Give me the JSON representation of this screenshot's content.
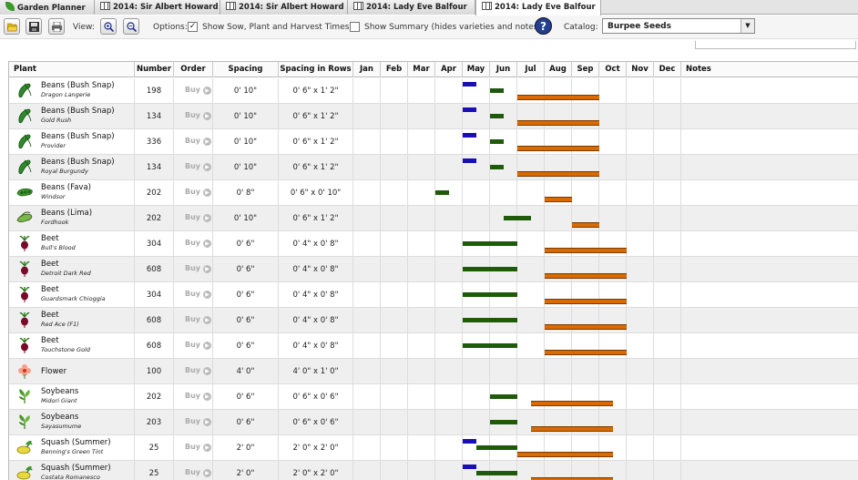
{
  "tabs": [
    {
      "label": "Garden Planner",
      "icon": "leaf-icon",
      "active": false
    },
    {
      "label": "2014: Sir Albert Howard",
      "icon": "grid-icon",
      "active": false
    },
    {
      "label": "2014: Sir Albert Howard",
      "icon": "grid-icon",
      "active": false
    },
    {
      "label": "2014: Lady Eve Balfour",
      "icon": "grid-icon",
      "active": false
    },
    {
      "label": "2014: Lady Eve Balfour",
      "icon": "grid-icon",
      "active": true
    }
  ],
  "toolbar": {
    "view_label": "View:",
    "options_label": "Options:",
    "show_times_label": "Show Sow, Plant and Harvest Times",
    "show_times_checked": true,
    "show_summary_label": "Show Summary (hides varieties and notes)",
    "show_summary_checked": false,
    "catalog_label": "Catalog:",
    "catalog_value": "Burpee Seeds",
    "help_glyph": "?"
  },
  "columns": [
    "Plant",
    "Number",
    "Order",
    "Spacing",
    "Spacing in Rows",
    "Jan",
    "Feb",
    "Mar",
    "Apr",
    "May",
    "Jun",
    "Jul",
    "Aug",
    "Sep",
    "Oct",
    "Nov",
    "Dec",
    "Notes"
  ],
  "buy_label": "Buy",
  "colors": {
    "sow": "#1a0fb5",
    "plant": "#1e5a0a",
    "harvest": "#d86a00"
  },
  "rows": [
    {
      "plant": "Beans (Bush Snap)",
      "variety": "Dragon Langerie",
      "icon": "bean-pod-icon",
      "number": "198",
      "spacing": "0' 10\"",
      "rows": "0' 6\" x 1' 2\"",
      "sow": [
        4.0,
        4.5
      ],
      "plant_t": [
        5.0,
        5.5
      ],
      "harvest": [
        6.0,
        9.0
      ]
    },
    {
      "plant": "Beans (Bush Snap)",
      "variety": "Gold Rush",
      "icon": "bean-pod-icon",
      "number": "134",
      "spacing": "0' 10\"",
      "rows": "0' 6\" x 1' 2\"",
      "sow": [
        4.0,
        4.5
      ],
      "plant_t": [
        5.0,
        5.5
      ],
      "harvest": [
        6.0,
        9.0
      ]
    },
    {
      "plant": "Beans (Bush Snap)",
      "variety": "Provider",
      "icon": "bean-pod-icon",
      "number": "336",
      "spacing": "0' 10\"",
      "rows": "0' 6\" x 1' 2\"",
      "sow": [
        4.0,
        4.5
      ],
      "plant_t": [
        5.0,
        5.5
      ],
      "harvest": [
        6.0,
        9.0
      ]
    },
    {
      "plant": "Beans (Bush Snap)",
      "variety": "Royal Burgundy",
      "icon": "bean-pod-icon",
      "number": "134",
      "spacing": "0' 10\"",
      "rows": "0' 6\" x 1' 2\"",
      "sow": [
        4.0,
        4.5
      ],
      "plant_t": [
        5.0,
        5.5
      ],
      "harvest": [
        6.0,
        9.0
      ]
    },
    {
      "plant": "Beans (Fava)",
      "variety": "Windsor",
      "icon": "fava-pod-icon",
      "number": "202",
      "spacing": "0' 8\"",
      "rows": "0' 6\" x 0' 10\"",
      "sow": null,
      "plant_t": [
        3.0,
        3.5
      ],
      "harvest": [
        7.0,
        8.0
      ]
    },
    {
      "plant": "Beans (Lima)",
      "variety": "Fordhook",
      "icon": "lima-pod-icon",
      "number": "202",
      "spacing": "0' 10\"",
      "rows": "0' 6\" x 1' 2\"",
      "sow": null,
      "plant_t": [
        5.5,
        6.5
      ],
      "harvest": [
        8.0,
        9.0
      ]
    },
    {
      "plant": "Beet",
      "variety": "Bull's Blood",
      "icon": "beet-icon",
      "number": "304",
      "spacing": "0' 6\"",
      "rows": "0' 4\" x 0' 8\"",
      "sow": null,
      "plant_t": [
        4.0,
        6.0
      ],
      "harvest": [
        7.0,
        10.0
      ]
    },
    {
      "plant": "Beet",
      "variety": "Detroit Dark Red",
      "icon": "beet-icon",
      "number": "608",
      "spacing": "0' 6\"",
      "rows": "0' 4\" x 0' 8\"",
      "sow": null,
      "plant_t": [
        4.0,
        6.0
      ],
      "harvest": [
        7.0,
        10.0
      ]
    },
    {
      "plant": "Beet",
      "variety": "Guardsmark Chioggia",
      "icon": "beet-icon",
      "number": "304",
      "spacing": "0' 6\"",
      "rows": "0' 4\" x 0' 8\"",
      "sow": null,
      "plant_t": [
        4.0,
        6.0
      ],
      "harvest": [
        7.0,
        10.0
      ]
    },
    {
      "plant": "Beet",
      "variety": "Red Ace (F1)",
      "icon": "beet-icon",
      "number": "608",
      "spacing": "0' 6\"",
      "rows": "0' 4\" x 0' 8\"",
      "sow": null,
      "plant_t": [
        4.0,
        6.0
      ],
      "harvest": [
        7.0,
        10.0
      ]
    },
    {
      "plant": "Beet",
      "variety": "Touchstone Gold",
      "icon": "beet-icon",
      "number": "608",
      "spacing": "0' 6\"",
      "rows": "0' 4\" x 0' 8\"",
      "sow": null,
      "plant_t": [
        4.0,
        6.0
      ],
      "harvest": [
        7.0,
        10.0
      ]
    },
    {
      "plant": "Flower",
      "variety": "",
      "icon": "flower-icon",
      "number": "100",
      "spacing": "4' 0\"",
      "rows": "4' 0\" x 1' 0\"",
      "sow": null,
      "plant_t": null,
      "harvest": null
    },
    {
      "plant": "Soybeans",
      "variety": "Midori Giant",
      "icon": "soybean-icon",
      "number": "202",
      "spacing": "0' 6\"",
      "rows": "0' 6\" x 0' 6\"",
      "sow": null,
      "plant_t": [
        5.0,
        6.0
      ],
      "harvest": [
        6.5,
        9.5
      ]
    },
    {
      "plant": "Soybeans",
      "variety": "Sayasumume",
      "icon": "soybean-icon",
      "number": "203",
      "spacing": "0' 6\"",
      "rows": "0' 6\" x 0' 6\"",
      "sow": null,
      "plant_t": [
        5.0,
        6.0
      ],
      "harvest": [
        6.5,
        9.5
      ]
    },
    {
      "plant": "Squash (Summer)",
      "variety": "Benning's Green Tint",
      "icon": "squash-icon",
      "number": "25",
      "spacing": "2' 0\"",
      "rows": "2' 0\" x 2' 0\"",
      "sow": [
        4.0,
        4.5
      ],
      "plant_t": [
        4.5,
        6.0
      ],
      "harvest": [
        6.0,
        9.5
      ]
    },
    {
      "plant": "Squash (Summer)",
      "variety": "Costata Romanesco",
      "icon": "squash-icon",
      "number": "25",
      "spacing": "2' 0\"",
      "rows": "2' 0\" x 2' 0\"",
      "sow": [
        4.0,
        4.5
      ],
      "plant_t": [
        4.5,
        6.0
      ],
      "harvest": [
        6.5,
        9.5
      ]
    }
  ]
}
